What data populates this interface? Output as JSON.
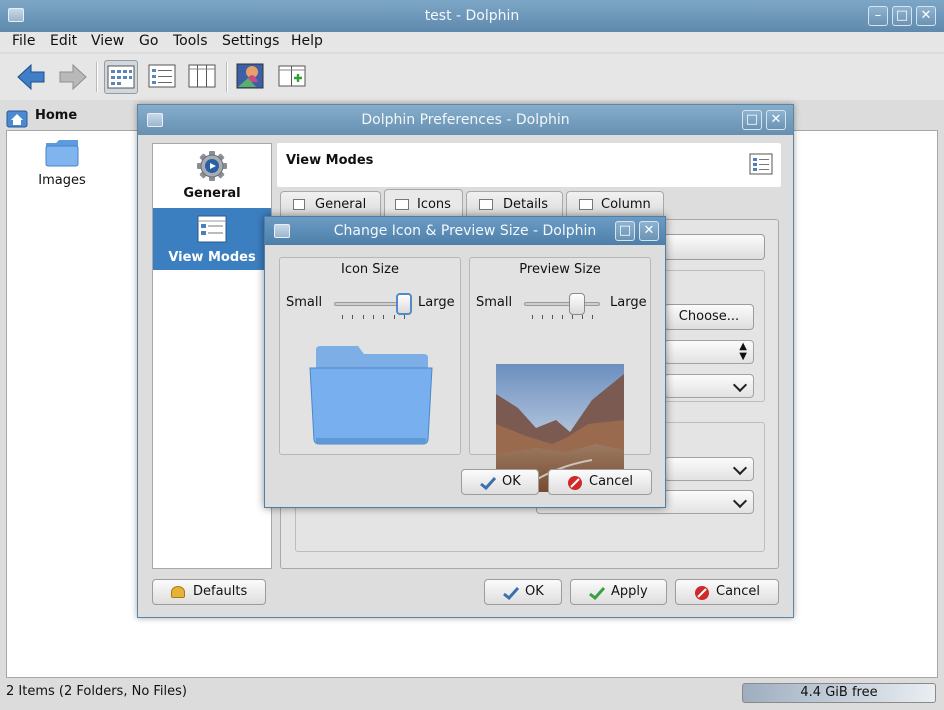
{
  "main_window": {
    "title": "test - Dolphin",
    "menu": [
      "File",
      "Edit",
      "View",
      "Go",
      "Tools",
      "Settings",
      "Help"
    ],
    "location": "Home",
    "items": [
      {
        "label": "Images"
      }
    ],
    "status": "2 Items (2 Folders, No Files)",
    "free_space": "4.4 GiB free"
  },
  "prefs_dialog": {
    "title": "Dolphin Preferences - Dolphin",
    "sidebar": [
      {
        "label": "General"
      },
      {
        "label": "View Modes"
      }
    ],
    "page_title": "View Modes",
    "tabs": [
      "General",
      "Icons",
      "Details",
      "Column"
    ],
    "choose_label": "Choose...",
    "defaults_label": "Defaults",
    "ok_label": "OK",
    "apply_label": "Apply",
    "cancel_label": "Cancel"
  },
  "size_dialog": {
    "title": "Change Icon & Preview Size - Dolphin",
    "icon_group": {
      "title": "Icon Size",
      "min_label": "Small",
      "max_label": "Large",
      "level": 1.0
    },
    "preview_group": {
      "title": "Preview Size",
      "min_label": "Small",
      "max_label": "Large",
      "level": 0.75
    },
    "ok_label": "OK",
    "cancel_label": "Cancel"
  },
  "colors": {
    "titlebar": "#6690b2",
    "selection": "#3c7fc1",
    "folder": "#6ea9e8"
  }
}
